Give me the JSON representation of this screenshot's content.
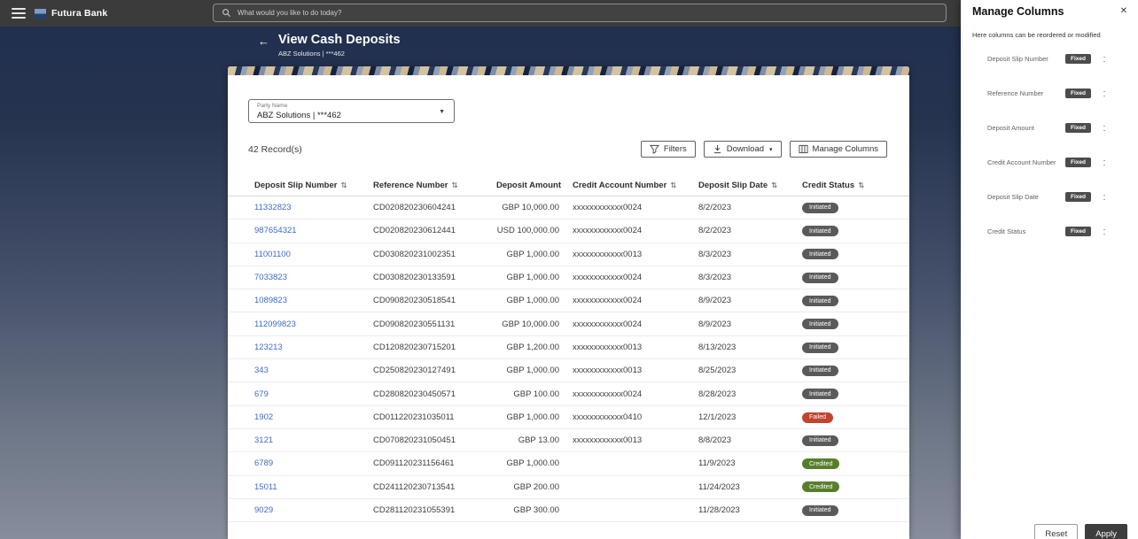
{
  "header": {
    "brand": "Futura Bank",
    "search_placeholder": "What would you like to do today?"
  },
  "page": {
    "title": "View Cash Deposits",
    "subtitle": "ABZ Solutions | ***462"
  },
  "card": {
    "party_label": "Party Name",
    "party_value": "ABZ Solutions | ***462",
    "record_count": "42 Record(s)",
    "buttons": {
      "filters": "Filters",
      "download": "Download",
      "manage_columns": "Manage Columns"
    }
  },
  "table": {
    "columns": [
      {
        "label": "Deposit Slip Number",
        "sortable": true,
        "align": "left"
      },
      {
        "label": "Reference Number",
        "sortable": true,
        "align": "left"
      },
      {
        "label": "Deposit Amount",
        "sortable": false,
        "align": "right"
      },
      {
        "label": "Credit Account Number",
        "sortable": true,
        "align": "left"
      },
      {
        "label": "Deposit Slip Date",
        "sortable": true,
        "align": "left"
      },
      {
        "label": "Credit Status",
        "sortable": true,
        "align": "left"
      }
    ],
    "rows": [
      {
        "deposit_slip_number": "11332823",
        "reference_number": "CD020820230604241",
        "deposit_amount": "GBP 10,000.00",
        "credit_account_number": "xxxxxxxxxxxx0024",
        "deposit_slip_date": "8/2/2023",
        "credit_status": "Initiated"
      },
      {
        "deposit_slip_number": "987654321",
        "reference_number": "CD020820230612441",
        "deposit_amount": "USD 100,000.00",
        "credit_account_number": "xxxxxxxxxxxx0024",
        "deposit_slip_date": "8/2/2023",
        "credit_status": "Initiated"
      },
      {
        "deposit_slip_number": "11001100",
        "reference_number": "CD030820231002351",
        "deposit_amount": "GBP 1,000.00",
        "credit_account_number": "xxxxxxxxxxxx0013",
        "deposit_slip_date": "8/3/2023",
        "credit_status": "Initiated"
      },
      {
        "deposit_slip_number": "7033823",
        "reference_number": "CD030820230133591",
        "deposit_amount": "GBP 1,000.00",
        "credit_account_number": "xxxxxxxxxxxx0024",
        "deposit_slip_date": "8/3/2023",
        "credit_status": "Initiated"
      },
      {
        "deposit_slip_number": "1089823",
        "reference_number": "CD090820230518541",
        "deposit_amount": "GBP 1,000.00",
        "credit_account_number": "xxxxxxxxxxxx0024",
        "deposit_slip_date": "8/9/2023",
        "credit_status": "Initiated"
      },
      {
        "deposit_slip_number": "112099823",
        "reference_number": "CD090820230551131",
        "deposit_amount": "GBP 10,000.00",
        "credit_account_number": "xxxxxxxxxxxx0024",
        "deposit_slip_date": "8/9/2023",
        "credit_status": "Initiated"
      },
      {
        "deposit_slip_number": "123213",
        "reference_number": "CD120820230715201",
        "deposit_amount": "GBP 1,200.00",
        "credit_account_number": "xxxxxxxxxxxx0013",
        "deposit_slip_date": "8/13/2023",
        "credit_status": "Initiated"
      },
      {
        "deposit_slip_number": "343",
        "reference_number": "CD250820230127491",
        "deposit_amount": "GBP 1,000.00",
        "credit_account_number": "xxxxxxxxxxxx0013",
        "deposit_slip_date": "8/25/2023",
        "credit_status": "Initiated"
      },
      {
        "deposit_slip_number": "679",
        "reference_number": "CD280820230450571",
        "deposit_amount": "GBP 100.00",
        "credit_account_number": "xxxxxxxxxxxx0024",
        "deposit_slip_date": "8/28/2023",
        "credit_status": "Initiated"
      },
      {
        "deposit_slip_number": "1902",
        "reference_number": "CD011220231035011",
        "deposit_amount": "GBP 1,000.00",
        "credit_account_number": "xxxxxxxxxxxx0410",
        "deposit_slip_date": "12/1/2023",
        "credit_status": "Failed"
      },
      {
        "deposit_slip_number": "3121",
        "reference_number": "CD070820231050451",
        "deposit_amount": "GBP 13.00",
        "credit_account_number": "xxxxxxxxxxxx0013",
        "deposit_slip_date": "8/8/2023",
        "credit_status": "Initiated"
      },
      {
        "deposit_slip_number": "6789",
        "reference_number": "CD091120231156461",
        "deposit_amount": "GBP 1,000.00",
        "credit_account_number": "",
        "deposit_slip_date": "11/9/2023",
        "credit_status": "Credited"
      },
      {
        "deposit_slip_number": "15011",
        "reference_number": "CD241120230713541",
        "deposit_amount": "GBP 200.00",
        "credit_account_number": "",
        "deposit_slip_date": "11/24/2023",
        "credit_status": "Credited"
      },
      {
        "deposit_slip_number": "9029",
        "reference_number": "CD281120231055391",
        "deposit_amount": "GBP 300.00",
        "credit_account_number": "",
        "deposit_slip_date": "11/28/2023",
        "credit_status": "Initiated"
      }
    ]
  },
  "panel": {
    "title": "Manage Columns",
    "description": "Here columns can be reordered or modified",
    "items": [
      {
        "label": "Deposit Slip Number",
        "badge": "Fixed"
      },
      {
        "label": "Reference Number",
        "badge": "Fixed"
      },
      {
        "label": "Deposit Amount",
        "badge": "Fixed"
      },
      {
        "label": "Credit Account Number",
        "badge": "Fixed"
      },
      {
        "label": "Deposit Slip Date",
        "badge": "Fixed"
      },
      {
        "label": "Credit Status",
        "badge": "Fixed"
      }
    ],
    "reset": "Reset",
    "apply": "Apply"
  },
  "icons": {
    "back": "←",
    "party_caret": "▼",
    "download_caret": "▾",
    "sort": "⇅",
    "close": "✕"
  },
  "colors": {
    "link": "#3f6bc5",
    "topbar": "#3b3b3b",
    "header_band": "#21304f"
  },
  "status_colors": {
    "Initiated": "#5a5a5a",
    "Failed": "#c0442e",
    "Credited": "#577f2b"
  }
}
